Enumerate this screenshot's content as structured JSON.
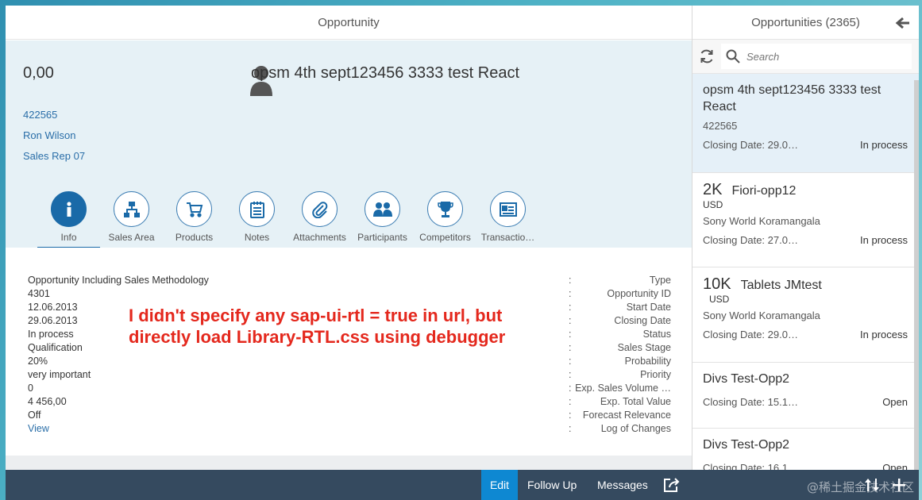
{
  "detail": {
    "title": "Opportunity",
    "header": {
      "number": "0,00",
      "title": "opsm 4th sept123456 3333 test React",
      "attributes": [
        "422565",
        "Ron Wilson",
        "Sales Rep 07"
      ]
    },
    "tabs": [
      {
        "label": "Info",
        "icon": "info-icon",
        "active": true
      },
      {
        "label": "Sales Area",
        "icon": "hierarchy-icon"
      },
      {
        "label": "Products",
        "icon": "cart-icon"
      },
      {
        "label": "Notes",
        "icon": "notes-icon"
      },
      {
        "label": "Attachments",
        "icon": "paperclip-icon"
      },
      {
        "label": "Participants",
        "icon": "people-icon"
      },
      {
        "label": "Competitors",
        "icon": "trophy-icon"
      },
      {
        "label": "Transactio…",
        "icon": "document-icon"
      }
    ],
    "form": {
      "values": [
        "Opportunity Including Sales Methodology",
        "4301",
        "12.06.2013",
        "29.06.2013",
        "In process",
        "Qualification",
        "20%",
        "very important",
        "0",
        "4 456,00",
        "Off",
        "View"
      ],
      "labels": [
        "Type",
        "Opportunity ID",
        "Start Date",
        "Closing Date",
        "Status",
        "Sales Stage",
        "Probability",
        "Priority",
        "Exp. Sales Volume …",
        "Exp. Total Value",
        "Forecast Relevance",
        "Log of Changes"
      ]
    },
    "annotation": [
      "I didn't specify any sap-ui-rtl = true in url, but",
      "directly load Library-RTL.css using debugger"
    ]
  },
  "master": {
    "title": "Opportunities (2365)",
    "search_placeholder": "Search",
    "items": [
      {
        "title": "opsm 4th sept123456 3333 test React",
        "attr": "422565",
        "closing": "Closing Date: 29.0…",
        "status": "In process",
        "selected": true
      },
      {
        "number": "2K",
        "unit": "USD",
        "title": "Fiori-opp12",
        "attr": "Sony World Koramangala",
        "closing": "Closing Date: 27.0…",
        "status": "In process"
      },
      {
        "number": "10K",
        "unit": "USD",
        "title": "Tablets JMtest",
        "attr": "Sony World Koramangala",
        "closing": "Closing Date: 29.0…",
        "status": "In process"
      },
      {
        "title": "Divs Test-Opp2",
        "closing": "Closing Date: 15.1…",
        "status": "Open"
      },
      {
        "title": "Divs Test-Opp2",
        "closing": "Closing Date: 16.1…",
        "status": "Open"
      }
    ]
  },
  "footer": {
    "edit": "Edit",
    "follow_up": "Follow Up",
    "messages": "Messages"
  },
  "watermark": "@稀土掘金技术社区",
  "colors": {
    "accent": "#1a6aa8",
    "footer": "#354a5f",
    "edit_button": "#0e88d2",
    "annotation": "#e4281d"
  }
}
